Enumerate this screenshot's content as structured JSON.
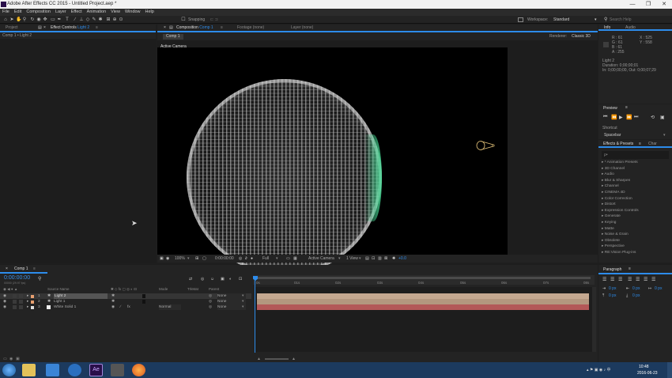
{
  "window": {
    "title": "Adobe After Effects CC 2015 - Untitled Project.aep *",
    "controls": [
      "—",
      "❐",
      "✕"
    ]
  },
  "menu": [
    "File",
    "Edit",
    "Composition",
    "Layer",
    "Effect",
    "Animation",
    "View",
    "Window",
    "Help"
  ],
  "toolbar": {
    "snapping_label": "Snapping",
    "workspace_label": "Workspace:",
    "workspace_value": "Standard",
    "search_placeholder": "Search Help"
  },
  "project_panel": {
    "tab_project": "Project",
    "tab_effect_controls": "Effect Controls",
    "effect_controls_target": "Light 2",
    "breadcrumb": "Comp 1 • Light 2"
  },
  "composition_panel": {
    "tab_composition": "Composition",
    "composition_name": "Comp 1",
    "tab_footage": "Footage (none)",
    "tab_layer": "Layer (none)",
    "comp_button": "Comp 1",
    "renderer_label": "Renderer:",
    "renderer_value": "Classic 3D",
    "view_label": "Active Camera",
    "zoom": "100%",
    "timecode": "0:00:00:00",
    "resolution": "Full",
    "camera_dropdown": "Active Camera",
    "views_dropdown": "1 View",
    "exposure": "+0.0"
  },
  "info_panel": {
    "tab_info": "Info",
    "tab_audio": "Audio",
    "r": "R : 61",
    "g": "G : 61",
    "b": "B : 61",
    "a": "A : 255",
    "x": "X : 525",
    "y": "Y : 558",
    "layer_name": "Light 2",
    "duration": "Duration: 0;00;00;01",
    "in_out": "In: 0;00;00;00, Out: 0;00;07;29"
  },
  "preview_panel": {
    "title": "Preview",
    "shortcut_label": "Shortcut",
    "shortcut_value": "Spacebar"
  },
  "effects_panel": {
    "tab_effects": "Effects & Presets",
    "tab_char": "Char",
    "search_placeholder": "ρ•",
    "items": [
      "* Animation Presets",
      "3D Channel",
      "Audio",
      "Blur & Sharpen",
      "Channel",
      "CINEMA 4D",
      "Color Correction",
      "Distort",
      "Expression Controls",
      "Generate",
      "Keying",
      "Matte",
      "Noise & Grain",
      "Obsolete",
      "Perspective",
      "RE:Vision Plug-ins"
    ]
  },
  "paragraph_panel": {
    "title": "Paragraph",
    "indent_left": "0 px",
    "indent_right": "0 px",
    "indent_first": "0 px",
    "space_before": "0 px",
    "space_after": "0 px"
  },
  "timeline": {
    "tab": "Comp 1",
    "timecode": "0:00:00:00",
    "frame_info": "00000 (29.97 fps)",
    "col_source": "Source Name",
    "col_mode": "Mode",
    "col_trkmat": "TrkMat",
    "col_parent": "Parent",
    "ruler_labels": [
      "0s",
      "01s",
      "02s",
      "03s",
      "04s",
      "05s",
      "06s",
      "07s",
      "08s"
    ],
    "layers": [
      {
        "num": "1",
        "name": "Light 2",
        "mode": "",
        "parent": "None",
        "color": "#e8a070",
        "bar": "#c4a890"
      },
      {
        "num": "2",
        "name": "Light 1",
        "mode": "",
        "parent": "None",
        "color": "#e8a070",
        "bar": "#b3977f"
      },
      {
        "num": "3",
        "name": "White Solid 1",
        "mode": "Normal",
        "parent": "None",
        "color": "#dddddd",
        "bar": "#b35858"
      }
    ]
  },
  "taskbar": {
    "clock_time": "10:48",
    "clock_date": "2016-06-23",
    "icons": [
      "windows-start-icon",
      "file-explorer-icon",
      "media-icon",
      "k-app-icon",
      "after-effects-icon",
      "video-editor-icon",
      "firefox-icon"
    ]
  },
  "colors": {
    "accent_blue": "#2d8ceb",
    "timecode_blue": "#3a8ee6",
    "playhead": "#2d8ceb",
    "glow_green": "#46dc96"
  }
}
